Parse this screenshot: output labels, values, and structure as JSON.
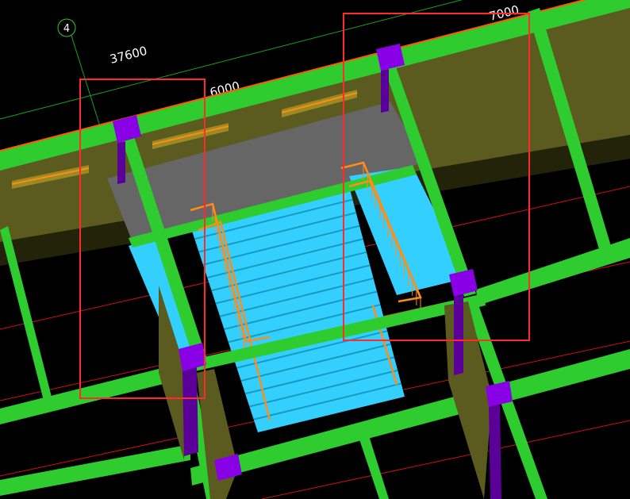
{
  "viewport": {
    "grid_axis_label": "4",
    "dimensions": [
      "37600",
      "6000",
      "7000"
    ]
  },
  "colors": {
    "background": "#000000",
    "beam": "#2ecc2e",
    "beam_dark": "#1e8f1e",
    "column": "#8a00e6",
    "column_dark": "#5a0099",
    "wall": "#5b5a1f",
    "wall_dark": "#3a3a10",
    "slab": "#666666",
    "stair": "#33d0ff",
    "stair_step": "#169ac0",
    "railing": "#ff8c1a",
    "selection_box": "#ff2a2a",
    "grid_line_green": "#1aa31a",
    "grid_line_red": "#d01010"
  },
  "icons": [
    "grid-axis-bubble-icon"
  ]
}
